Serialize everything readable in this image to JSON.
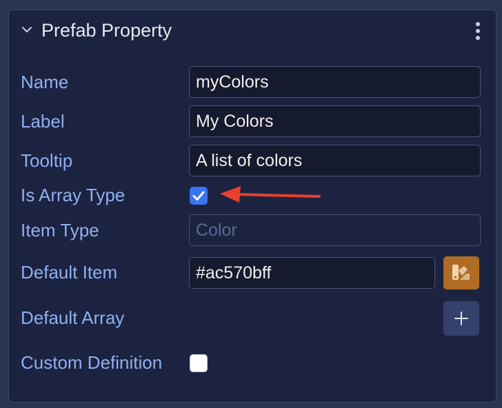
{
  "panel": {
    "title": "Prefab Property"
  },
  "fields": {
    "name": {
      "label": "Name",
      "value": "myColors"
    },
    "label": {
      "label": "Label",
      "value": "My Colors"
    },
    "tooltip": {
      "label": "Tooltip",
      "value": "A list of colors"
    },
    "is_array_type": {
      "label": "Is Array Type",
      "checked": true
    },
    "item_type": {
      "label": "Item Type",
      "placeholder": "Color"
    },
    "default_item": {
      "label": "Default Item",
      "value": "#ac570bff"
    },
    "default_array": {
      "label": "Default Array"
    },
    "custom_definition": {
      "label": "Custom Definition",
      "checked": false
    }
  },
  "icons": {
    "collapse": "chevron-down-icon",
    "menu": "kebab-menu-icon",
    "picker": "color-picker-icon",
    "add": "plus-icon",
    "check": "checkmark-icon",
    "annotation": "red-arrow-icon"
  },
  "colors": {
    "panel_bg": "#1c2340",
    "label": "#8fb0f0",
    "accent_check": "#3a74f0",
    "picker_button": "#b06c22",
    "add_button": "#34426b",
    "annotation_arrow": "#e8402c"
  }
}
